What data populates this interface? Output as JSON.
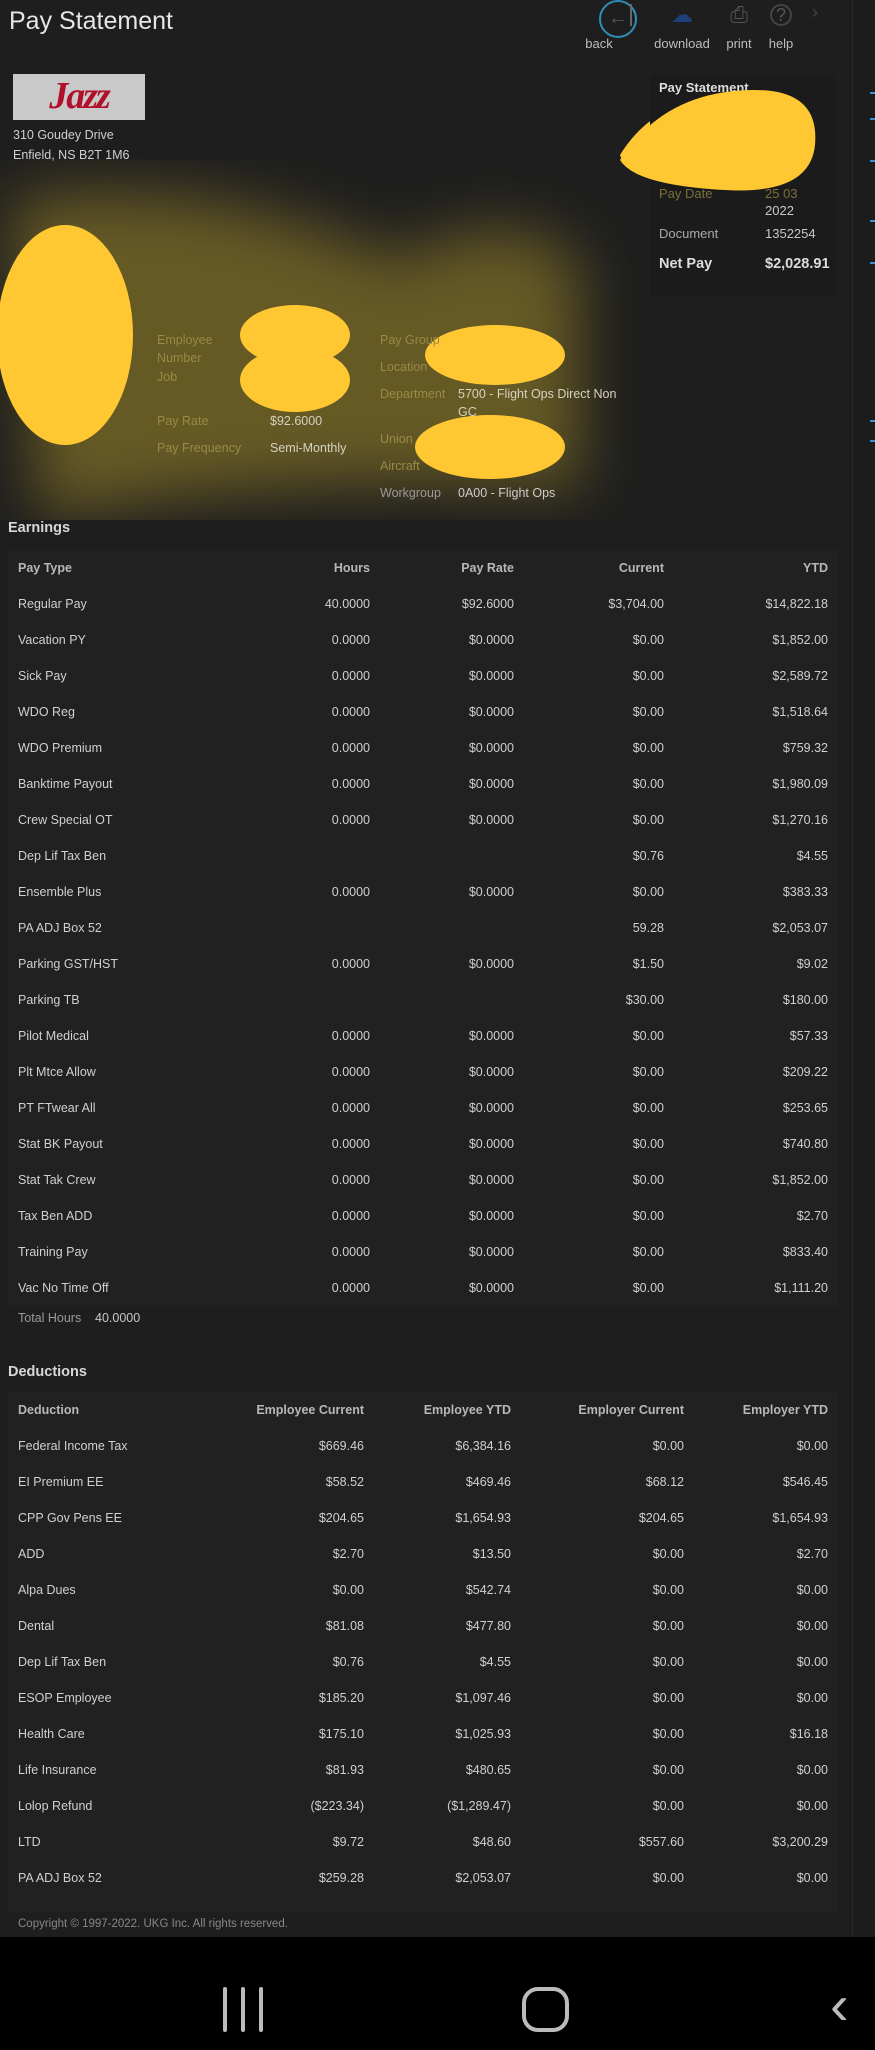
{
  "header": {
    "title": "Pay Statement",
    "toolbar": [
      {
        "label": "back",
        "icon": "arrow-left-icon"
      },
      {
        "label": "download",
        "icon": "download-icon"
      },
      {
        "label": "print",
        "icon": "printer-icon"
      },
      {
        "label": "help",
        "icon": "help-icon"
      }
    ]
  },
  "company": {
    "logo_text": "Jazz",
    "address_line1": "310 Goudey Drive",
    "address_line2": "Enfield, NS B2T 1M6"
  },
  "summary": {
    "title": "Pay Statement",
    "pay_date_label": "Pay Date",
    "pay_date_value_1": "25 03",
    "pay_date_value_2": "2022",
    "document_label": "Document",
    "document_value": "1352254",
    "net_pay_label": "Net Pay",
    "net_pay_value": "$2,028.91"
  },
  "employee": {
    "employee_number_label_1": "Employee",
    "employee_number_label_2": "Number",
    "job_label": "Job",
    "pay_rate_label": "Pay Rate",
    "pay_rate_value": "$92.6000",
    "pay_frequency_label": "Pay Frequency",
    "pay_frequency_value": "Semi-Monthly",
    "pay_group_label": "Pay Group",
    "location_label": "Location",
    "department_label": "Department",
    "department_value_1": "5700 - Flight Ops Direct Non",
    "department_value_2": "GC",
    "union_label": "Union",
    "aircraft_label": "Aircraft",
    "workgroup_label": "Workgroup",
    "workgroup_value": "0A00 - Flight Ops"
  },
  "earnings": {
    "title": "Earnings",
    "columns": [
      "Pay Type",
      "Hours",
      "Pay Rate",
      "Current",
      "YTD"
    ],
    "rows": [
      [
        "Regular Pay",
        "40.0000",
        "$92.6000",
        "$3,704.00",
        "$14,822.18"
      ],
      [
        "Vacation PY",
        "0.0000",
        "$0.0000",
        "$0.00",
        "$1,852.00"
      ],
      [
        "Sick Pay",
        "0.0000",
        "$0.0000",
        "$0.00",
        "$2,589.72"
      ],
      [
        "WDO Reg",
        "0.0000",
        "$0.0000",
        "$0.00",
        "$1,518.64"
      ],
      [
        "WDO Premium",
        "0.0000",
        "$0.0000",
        "$0.00",
        "$759.32"
      ],
      [
        "Banktime Payout",
        "0.0000",
        "$0.0000",
        "$0.00",
        "$1,980.09"
      ],
      [
        "Crew Special OT",
        "0.0000",
        "$0.0000",
        "$0.00",
        "$1,270.16"
      ],
      [
        "Dep Lif Tax Ben",
        "",
        "",
        "$0.76",
        "$4.55"
      ],
      [
        "Ensemble Plus",
        "0.0000",
        "$0.0000",
        "$0.00",
        "$383.33"
      ],
      [
        "PA ADJ Box 52",
        "",
        "",
        "59.28",
        "$2,053.07"
      ],
      [
        "Parking GST/HST",
        "0.0000",
        "$0.0000",
        "$1.50",
        "$9.02"
      ],
      [
        "Parking TB",
        "",
        "",
        "$30.00",
        "$180.00"
      ],
      [
        "Pilot Medical",
        "0.0000",
        "$0.0000",
        "$0.00",
        "$57.33"
      ],
      [
        "Plt Mtce Allow",
        "0.0000",
        "$0.0000",
        "$0.00",
        "$209.22"
      ],
      [
        "PT FTwear All",
        "0.0000",
        "$0.0000",
        "$0.00",
        "$253.65"
      ],
      [
        "Stat BK Payout",
        "0.0000",
        "$0.0000",
        "$0.00",
        "$740.80"
      ],
      [
        "Stat Tak Crew",
        "0.0000",
        "$0.0000",
        "$0.00",
        "$1,852.00"
      ],
      [
        "Tax Ben ADD",
        "0.0000",
        "$0.0000",
        "$0.00",
        "$2.70"
      ],
      [
        "Training Pay",
        "0.0000",
        "$0.0000",
        "$0.00",
        "$833.40"
      ],
      [
        "Vac No Time Off",
        "0.0000",
        "$0.0000",
        "$0.00",
        "$1,111.20"
      ]
    ],
    "total_hours_label": "Total Hours",
    "total_hours_value": "40.0000"
  },
  "deductions": {
    "title": "Deductions",
    "columns": [
      "Deduction",
      "Employee Current",
      "Employee YTD",
      "Employer Current",
      "Employer YTD"
    ],
    "rows": [
      [
        "Federal Income Tax",
        "$669.46",
        "$6,384.16",
        "$0.00",
        "$0.00"
      ],
      [
        "EI Premium EE",
        "$58.52",
        "$469.46",
        "$68.12",
        "$546.45"
      ],
      [
        "CPP Gov Pens EE",
        "$204.65",
        "$1,654.93",
        "$204.65",
        "$1,654.93"
      ],
      [
        "ADD",
        "$2.70",
        "$13.50",
        "$0.00",
        "$2.70"
      ],
      [
        "Alpa Dues",
        "$0.00",
        "$542.74",
        "$0.00",
        "$0.00"
      ],
      [
        "Dental",
        "$81.08",
        "$477.80",
        "$0.00",
        "$0.00"
      ],
      [
        "Dep Lif Tax Ben",
        "$0.76",
        "$4.55",
        "$0.00",
        "$0.00"
      ],
      [
        "ESOP Employee",
        "$185.20",
        "$1,097.46",
        "$0.00",
        "$0.00"
      ],
      [
        "Health Care",
        "$175.10",
        "$1,025.93",
        "$0.00",
        "$16.18"
      ],
      [
        "Life Insurance",
        "$81.93",
        "$480.65",
        "$0.00",
        "$0.00"
      ],
      [
        "Lolop Refund",
        "($223.34)",
        "($1,289.47)",
        "$0.00",
        "$0.00"
      ],
      [
        "LTD",
        "$9.72",
        "$48.60",
        "$557.60",
        "$3,200.29"
      ],
      [
        "PA ADJ Box 52",
        "$259.28",
        "$2,053.07",
        "$0.00",
        "$0.00"
      ]
    ]
  },
  "footer": {
    "copyright": "Copyright © 1997-2022. UKG Inc. All rights reserved."
  },
  "android_nav": {
    "recents_icon": "recents-icon",
    "home_icon": "home-icon",
    "back_icon": "back-chevron-icon"
  },
  "colors": {
    "background": "#1e1e1e",
    "accent": "#2d8fb8",
    "redaction": "#ffc832",
    "link": "#3b8fd1"
  }
}
